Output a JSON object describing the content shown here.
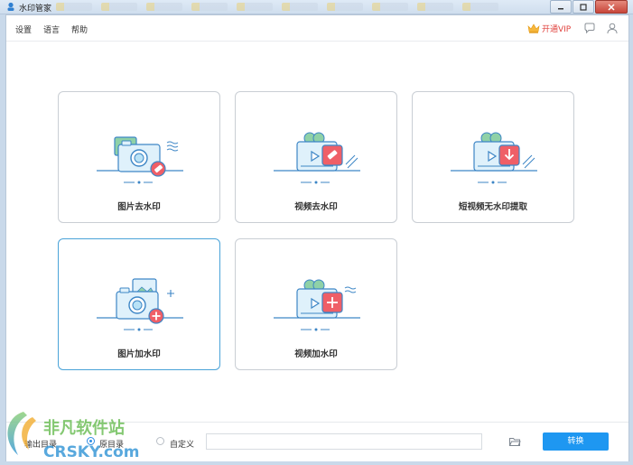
{
  "window": {
    "title": "水印管家"
  },
  "menu": {
    "items": [
      "设置",
      "语言",
      "帮助"
    ]
  },
  "toolbar": {
    "vip_label": "开通VIP"
  },
  "colors": {
    "accent": "#1e97f1",
    "vip": "#e0423d",
    "active_border": "#4aa3d8",
    "icon_blue": "#3d86c6",
    "icon_red": "#ef5f67",
    "icon_green": "#8fd1a7"
  },
  "cards": [
    {
      "label": "图片去水印",
      "icon": "camera-eraser-icon"
    },
    {
      "label": "视频去水印",
      "icon": "video-eraser-icon"
    },
    {
      "label": "短视频无水印提取",
      "icon": "video-download-icon"
    },
    {
      "label": "图片加水印",
      "icon": "camera-add-icon",
      "selected": true
    },
    {
      "label": "视频加水印",
      "icon": "video-add-icon"
    }
  ],
  "bottom": {
    "output_label": "输出目录",
    "options": [
      "原目录",
      "自定义"
    ],
    "selected_option": "原目录",
    "path_value": "",
    "convert_label": "转换"
  },
  "watermark": {
    "brand_text": "非凡软件站",
    "brand_url": "CRSKY.com"
  }
}
